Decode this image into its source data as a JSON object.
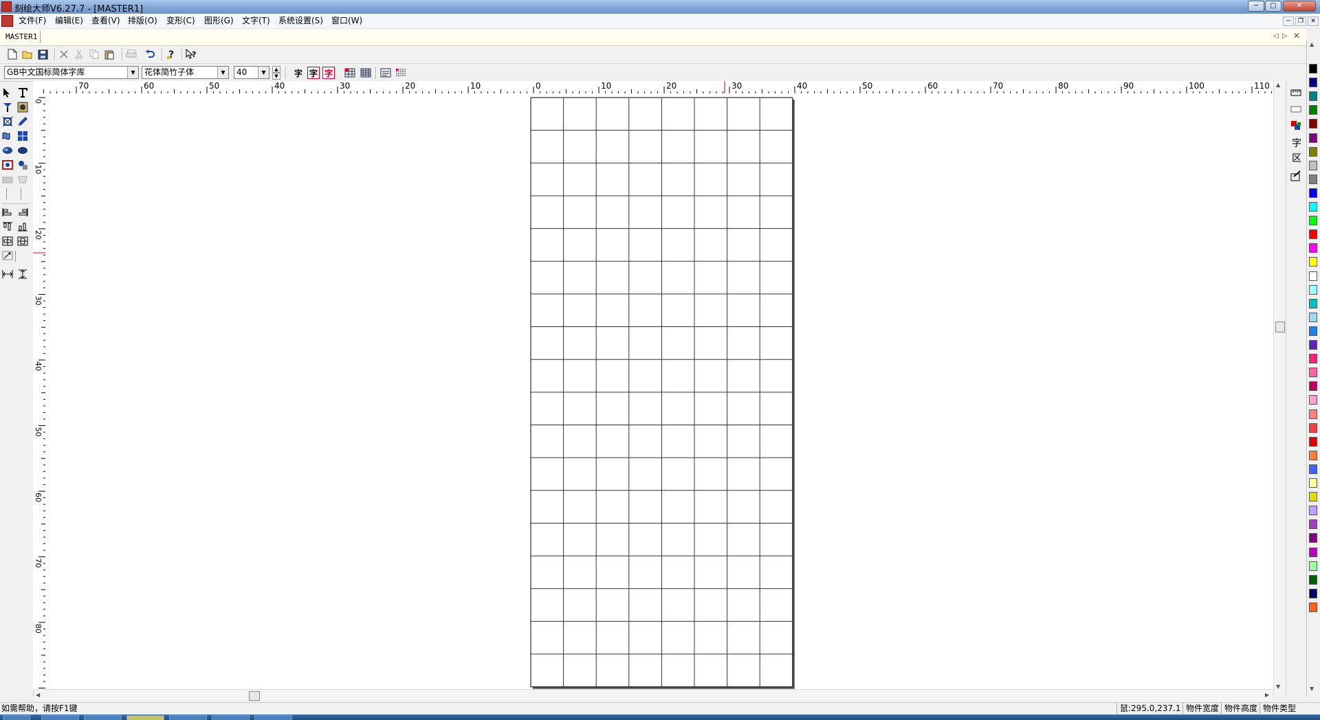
{
  "window": {
    "title": "刻绘大师V6.27.7 - [MASTER1]",
    "minimize_glyph": "─",
    "maximize_glyph": "□",
    "close_glyph": "✕"
  },
  "menu": {
    "items": [
      "文件(F)",
      "编辑(E)",
      "查看(V)",
      "排版(O)",
      "变形(C)",
      "图形(G)",
      "文字(T)",
      "系统设置(S)",
      "窗口(W)"
    ],
    "mdi_minimize": "─",
    "mdi_restore": "❐",
    "mdi_close": "✕"
  },
  "tabs": {
    "active": "MASTER1",
    "nav_prev": "◁",
    "nav_next": "▷",
    "close": "✕"
  },
  "toolbar2": {
    "font_library": "GB中文国标简体字库",
    "font_name": "花体简竹子体",
    "font_size": "40",
    "char_glyph": "字"
  },
  "ruler": {
    "top_labels": [
      "70",
      "60",
      "50",
      "40",
      "30",
      "20",
      "10",
      "0",
      "10",
      "20",
      "30",
      "40",
      "50",
      "60",
      "70",
      "80",
      "90",
      "100",
      "110"
    ],
    "left_labels": [
      "0",
      "10",
      "20",
      "30",
      "40",
      "50",
      "60",
      "70",
      "80"
    ]
  },
  "grid": {
    "columns": 8,
    "rows": 18
  },
  "right_panel": {
    "char_label": "字",
    "region_label": "区"
  },
  "palette": {
    "colors": [
      "#000000",
      "#000080",
      "#008080",
      "#008000",
      "#800000",
      "#800080",
      "#808000",
      "#c0c0c0",
      "#808080",
      "#0000ff",
      "#00ffff",
      "#00ff00",
      "#ff0000",
      "#ff00ff",
      "#ffff00",
      "#ffffff",
      "#a0ffff",
      "#00c0c0",
      "#a0d8f0",
      "#2080f0",
      "#6020c0",
      "#ff2080",
      "#ff60a0",
      "#c00060",
      "#ffa0d0",
      "#ff8080",
      "#ff4040",
      "#e00000",
      "#ff8040",
      "#4060ff",
      "#ffffa0",
      "#e0e000",
      "#c0a0ff",
      "#a040c0",
      "#800080",
      "#c000c0",
      "#a0ffa0",
      "#006000",
      "#000060",
      "#ff6020"
    ]
  },
  "statusbar": {
    "help": "如需帮助，请按F1键",
    "mouse": "鼠:295.0,237.1",
    "obj_width": "物件宽度",
    "obj_height": "物件高度",
    "obj_type": "物件类型"
  }
}
